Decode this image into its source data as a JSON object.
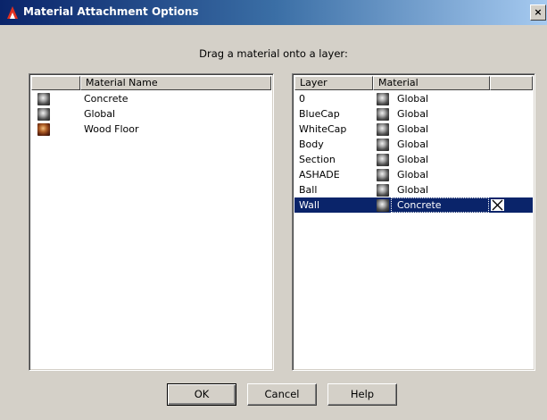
{
  "window": {
    "title": "Material Attachment Options",
    "close_glyph": "×"
  },
  "instruction": "Drag a material onto a layer:",
  "materials_panel": {
    "column_headers": [
      "",
      "Material Name"
    ],
    "items": [
      {
        "name": "Concrete",
        "swatch": "grey-sphere"
      },
      {
        "name": "Global",
        "swatch": "grey-sphere"
      },
      {
        "name": "Wood Floor",
        "swatch": "wood-sphere"
      }
    ]
  },
  "layers_panel": {
    "column_headers": [
      "Layer",
      "Material",
      ""
    ],
    "rows": [
      {
        "layer": "0",
        "material": "Global",
        "swatch": "grey-sphere",
        "selected": false
      },
      {
        "layer": "BlueCap",
        "material": "Global",
        "swatch": "grey-sphere",
        "selected": false
      },
      {
        "layer": "WhiteCap",
        "material": "Global",
        "swatch": "grey-sphere",
        "selected": false
      },
      {
        "layer": "Body",
        "material": "Global",
        "swatch": "grey-sphere",
        "selected": false
      },
      {
        "layer": "Section",
        "material": "Global",
        "swatch": "grey-sphere",
        "selected": false
      },
      {
        "layer": "ASHADE",
        "material": "Global",
        "swatch": "grey-sphere",
        "selected": false
      },
      {
        "layer": "Ball",
        "material": "Global",
        "swatch": "grey-sphere",
        "selected": false
      },
      {
        "layer": "Wall",
        "material": "Concrete",
        "swatch": "grey-sphere",
        "selected": true
      }
    ],
    "detach_icon": "x-icon"
  },
  "buttons": {
    "ok": "OK",
    "cancel": "Cancel",
    "help": "Help"
  },
  "colors": {
    "selection": "#0a246a",
    "dialog_bg": "#d4d0c8"
  }
}
